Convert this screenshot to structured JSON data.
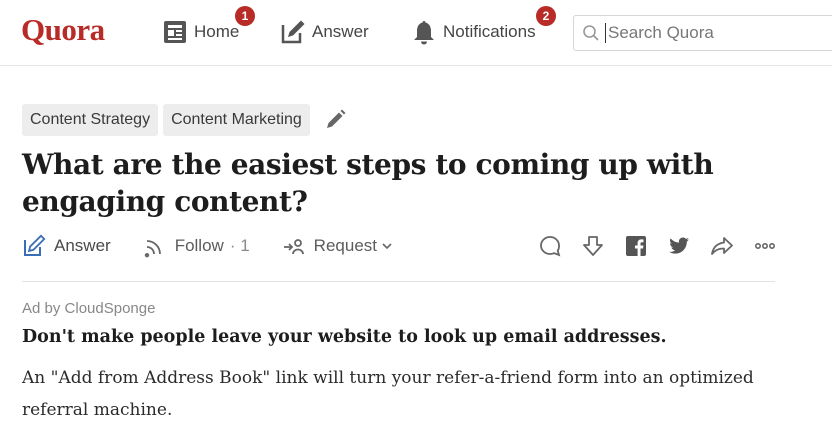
{
  "app": {
    "logo": "Quora"
  },
  "nav": {
    "home": {
      "label": "Home",
      "badge": "1",
      "icon": "home-feed-icon"
    },
    "answer": {
      "label": "Answer",
      "icon": "pencil-square-icon"
    },
    "notifications": {
      "label": "Notifications",
      "badge": "2",
      "icon": "bell-icon"
    },
    "search": {
      "placeholder": "Search Quora",
      "value": "",
      "icon": "search-icon"
    }
  },
  "question": {
    "topics": [
      "Content Strategy",
      "Content Marketing"
    ],
    "title": "What are the easiest steps to coming up with engaging content?",
    "actions": {
      "answer_label": "Answer",
      "follow_label": "Follow",
      "follow_count": "1",
      "request_label": "Request",
      "right_icons": [
        "comment-icon",
        "downvote-icon",
        "facebook-icon",
        "twitter-icon",
        "share-icon",
        "more-icon"
      ]
    }
  },
  "ad": {
    "label": "Ad by CloudSponge",
    "headline": "Don't make people leave your website to look up email addresses.",
    "body": "An \"Add from Address Book\" link will turn your refer-a-friend form into an optimized referral machine."
  },
  "colors": {
    "brand": "#b92b27",
    "badge": "#b92b27",
    "answer_accent": "#3a6fb5"
  }
}
